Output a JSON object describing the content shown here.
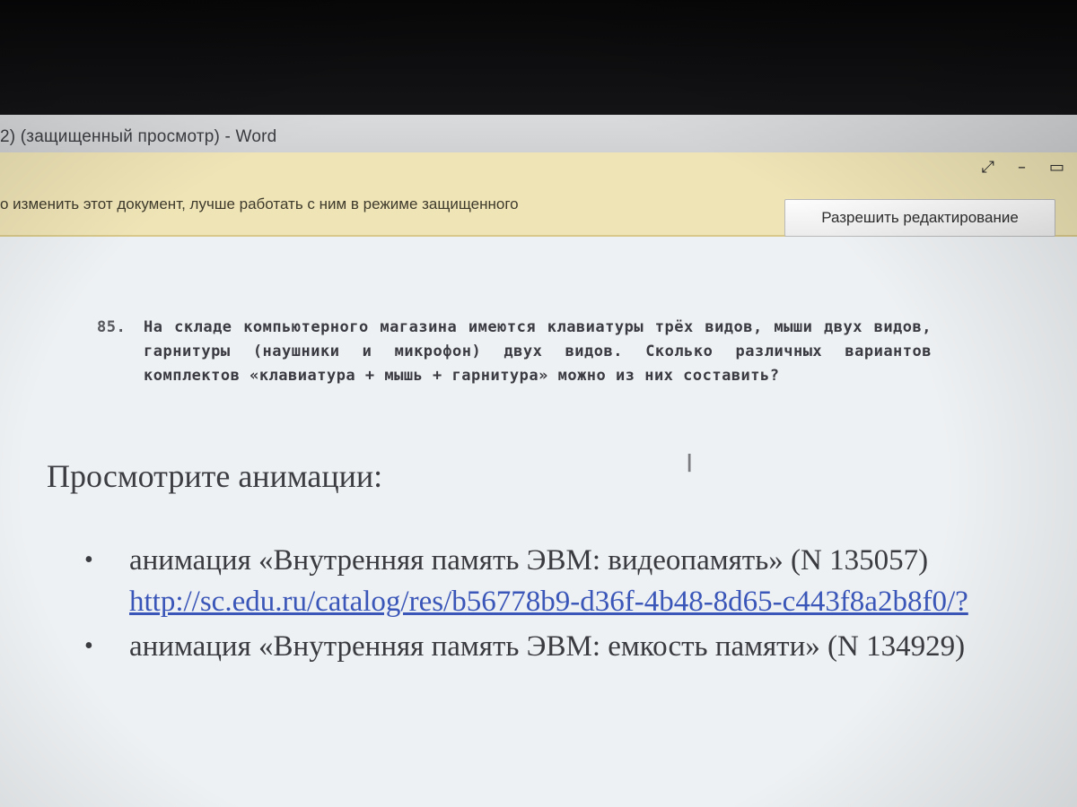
{
  "window": {
    "title": "2) (защищенный просмотр) - Word"
  },
  "controls": {
    "restore_icon": "restore-icon",
    "minimize_icon": "minimize-icon",
    "maximize_icon": "maximize-icon"
  },
  "message_bar": {
    "text": "о изменить этот документ, лучше работать с ним в режиме защищенного",
    "enable_editing_label": "Разрешить редактирование"
  },
  "document": {
    "task": {
      "number": "85.",
      "text": "На складе компьютерного магазина имеются клавиатуры трёх видов, мыши двух видов, гарнитуры (наушники и микрофон) двух видов. Сколько различных вариантов комплектов «клавиатура + мышь + гарнитура» можно из них составить?"
    },
    "heading": "Просмотрите анимации:",
    "items": [
      {
        "text": "анимация «Внутренняя память ЭВМ: видеопамять» (N 135057)",
        "link": "http://sc.edu.ru/catalog/res/b56778b9-d36f-4b48-8d65-c443f8a2b8f0/?"
      },
      {
        "text": "анимация «Внутренняя память ЭВМ: емкость памяти» (N 134929)",
        "link": ""
      }
    ]
  },
  "colors": {
    "message_bar": "#efe4b6",
    "link": "#3a56b8",
    "document_bg": "#eef1f3"
  }
}
